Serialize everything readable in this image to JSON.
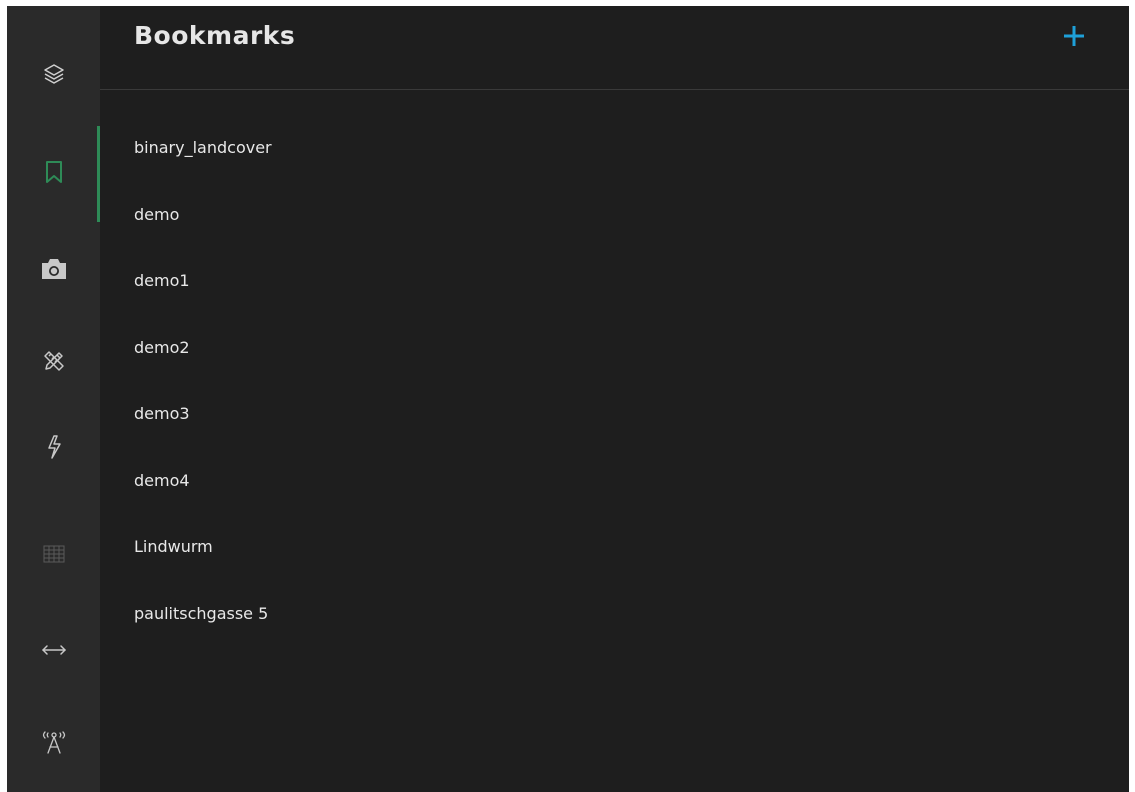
{
  "sidebar": {
    "items": [
      {
        "name": "layers",
        "icon": "layers-icon",
        "active": false
      },
      {
        "name": "bookmarks",
        "icon": "bookmark-icon",
        "active": true
      },
      {
        "name": "screenshot",
        "icon": "camera-icon",
        "active": false
      },
      {
        "name": "draw",
        "icon": "pencil-ruler-icon",
        "active": false
      },
      {
        "name": "analysis",
        "icon": "lightning-icon",
        "active": false
      },
      {
        "name": "grid",
        "icon": "grid-icon",
        "active": false
      },
      {
        "name": "measure",
        "icon": "double-arrow-icon",
        "active": false
      },
      {
        "name": "sensors",
        "icon": "antenna-icon",
        "active": false
      }
    ],
    "active_color": "#2e8b57",
    "icon_color": "#c8c8c8"
  },
  "panel": {
    "title": "Bookmarks",
    "add_icon": "plus-icon",
    "add_color": "#1ea0d8"
  },
  "bookmarks": [
    "binary_landcover",
    "demo",
    "demo1",
    "demo2",
    "demo3",
    "demo4",
    "Lindwurm",
    "paulitschgasse 5"
  ]
}
